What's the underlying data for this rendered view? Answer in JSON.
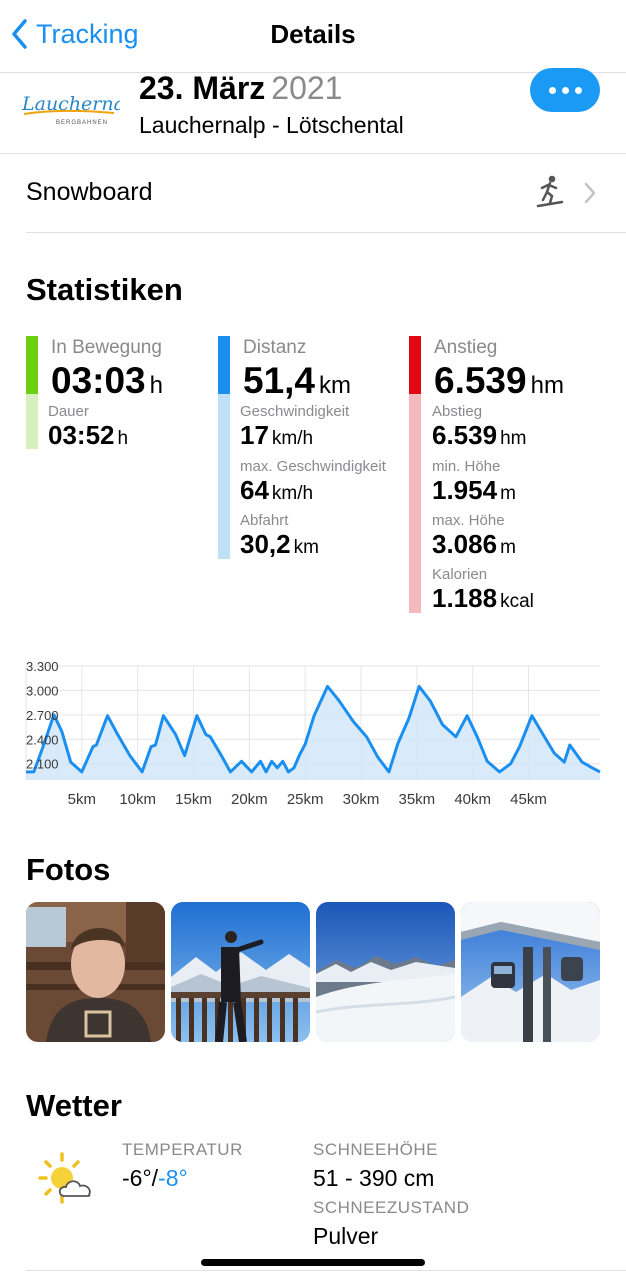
{
  "nav": {
    "back_label": "Tracking",
    "title": "Details"
  },
  "header": {
    "date": "23. März",
    "year": "2021",
    "resort": "Lauchernalp - Lötschental",
    "logo_text": "Lauchernalp",
    "logo_sub": "BERGBAHNEN"
  },
  "activity": {
    "label": "Snowboard"
  },
  "stats": {
    "title": "Statistiken",
    "motion": {
      "label": "In Bewegung",
      "value": "03:03",
      "unit": "h",
      "color": "#6ccf12",
      "light": "#d6f0c0",
      "items": [
        {
          "label": "Dauer",
          "value": "03:52",
          "unit": "h"
        }
      ]
    },
    "distance": {
      "label": "Distanz",
      "value": "51,4",
      "unit": "km",
      "color": "#1a8ff0",
      "light": "#bfe1f7",
      "items": [
        {
          "label": "Geschwindigkeit",
          "value": "17",
          "unit": "km/h"
        },
        {
          "label": "max. Geschwindigkeit",
          "value": "64",
          "unit": "km/h"
        },
        {
          "label": "Abfahrt",
          "value": "30,2",
          "unit": "km"
        }
      ]
    },
    "ascent": {
      "label": "Anstieg",
      "value": "6.539",
      "unit": "hm",
      "color": "#e30613",
      "light": "#f3b9bd",
      "items": [
        {
          "label": "Abstieg",
          "value": "6.539",
          "unit": "hm"
        },
        {
          "label": "min. Höhe",
          "value": "1.954",
          "unit": "m"
        },
        {
          "label": "max. Höhe",
          "value": "3.086",
          "unit": "m"
        },
        {
          "label": "Kalorien",
          "value": "1.188",
          "unit": "kcal"
        }
      ]
    }
  },
  "chart_data": {
    "type": "area",
    "title": "",
    "xlabel": "",
    "ylabel": "",
    "x_ticks": [
      "5km",
      "10km",
      "15km",
      "20km",
      "25km",
      "30km",
      "35km",
      "40km",
      "45km"
    ],
    "y_ticks": [
      "3.300",
      "3.000",
      "2.700",
      "2.400",
      "2.100"
    ],
    "xlim": [
      0,
      51.4
    ],
    "ylim": [
      1900,
      3300
    ],
    "color": "#1a8ff0",
    "series": [
      {
        "x": [
          0,
          0.7,
          1.5,
          2.5,
          3.2,
          4.0,
          5.0,
          6.0,
          6.3,
          7.3,
          8.2,
          9.3,
          10.4,
          11.2,
          11.6,
          12.3,
          13.4,
          14.2,
          15.3,
          16.1,
          16.5,
          17.5,
          18.3,
          19.3,
          20.2,
          21.0,
          21.5,
          22.0,
          22.5,
          23.0,
          23.5,
          24.0,
          24.5,
          25.0,
          25.8,
          27.0,
          28.0,
          29.3,
          30.5,
          31.5,
          32.5,
          33.3,
          34.3,
          35.2,
          36.2,
          37.3,
          38.5,
          39.5,
          40.4,
          41.3,
          42.4,
          43.4,
          44.2,
          45.3,
          46.3,
          47.3,
          48.2,
          48.7,
          49.8,
          50.7,
          51.4
        ],
        "y": [
          2000,
          2000,
          2300,
          2700,
          2500,
          2120,
          2000,
          2310,
          2330,
          2690,
          2460,
          2200,
          2000,
          2310,
          2330,
          2690,
          2460,
          2200,
          2690,
          2460,
          2430,
          2200,
          2000,
          2130,
          2000,
          2130,
          2000,
          2130,
          2050,
          2130,
          2000,
          2050,
          2210,
          2340,
          2690,
          3050,
          2880,
          2620,
          2430,
          2180,
          2000,
          2350,
          2660,
          3050,
          2870,
          2580,
          2430,
          2690,
          2430,
          2130,
          2000,
          2100,
          2310,
          2690,
          2460,
          2230,
          2120,
          2330,
          2120,
          2050,
          2000
        ]
      }
    ]
  },
  "photos": {
    "title": "Fotos",
    "items": [
      {
        "label": "Selfie vor Holzhütte"
      },
      {
        "label": "Person auf Terrasse"
      },
      {
        "label": "Bergpanorama"
      },
      {
        "label": "Gondelbahn Station"
      }
    ]
  },
  "weather": {
    "title": "Wetter",
    "icon": "sun-cloud-icon",
    "temp_label": "TEMPERATUR",
    "temp_high": "-6°/",
    "temp_low": "-8°",
    "snow_label": "SCHNEEHÖHE",
    "snow_value": "51 - 390 cm",
    "cond_label": "SCHNEEZUSTAND",
    "cond_value": "Pulver"
  }
}
